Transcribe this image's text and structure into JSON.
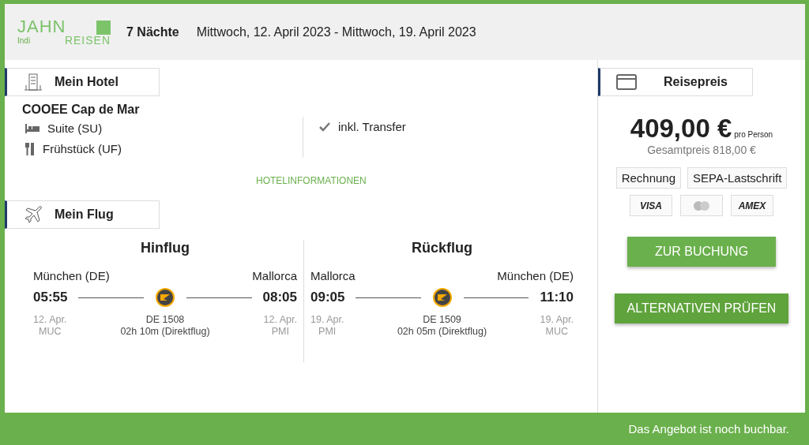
{
  "logo": {
    "top": "JAHN",
    "left": "Indi",
    "right": "REISEN"
  },
  "header": {
    "nights": "7 Nächte",
    "dates": "Mittwoch, 12. April 2023 - Mittwoch, 19. April 2023"
  },
  "hotel": {
    "section_title": "Mein Hotel",
    "name": "COOEE Cap de Mar",
    "room": "Suite (SU)",
    "board": "Frühstück (UF)",
    "transfer": "inkl. Transfer",
    "link": "HOTELINFORMATIONEN"
  },
  "flight": {
    "section_title": "Mein Flug",
    "legs": [
      {
        "title": "Hinflug",
        "from": "München (DE)",
        "to": "Mallorca",
        "dep": "05:55",
        "arr": "08:05",
        "dep_date": "12. Apr.",
        "dep_code": "MUC",
        "arr_date": "12. Apr.",
        "arr_code": "PMI",
        "number": "DE 1508",
        "duration": "02h 10m (Direktflug)"
      },
      {
        "title": "Rückflug",
        "from": "Mallorca",
        "to": "München (DE)",
        "dep": "09:05",
        "arr": "11:10",
        "dep_date": "19. Apr.",
        "dep_code": "PMI",
        "arr_date": "19. Apr.",
        "arr_code": "MUC",
        "number": "DE 1509",
        "duration": "02h 05m (Direktflug)"
      }
    ]
  },
  "price": {
    "section_title": "Reisepreis",
    "amount": "409,00 €",
    "per": "pro Person",
    "total": "Gesamtpreis 818,00 €",
    "payment_methods": [
      "Rechnung",
      "SEPA-Lastschrift"
    ],
    "cards": [
      {
        "kind": "visa",
        "label": "VISA"
      },
      {
        "kind": "mastercard"
      },
      {
        "kind": "amex",
        "label": "AMEX"
      }
    ],
    "book_button": "ZUR BUCHUNG",
    "alt_button": "ALTERNATIVEN PRÜFEN"
  },
  "status_bar": "Das Angebot ist noch buchbar."
}
